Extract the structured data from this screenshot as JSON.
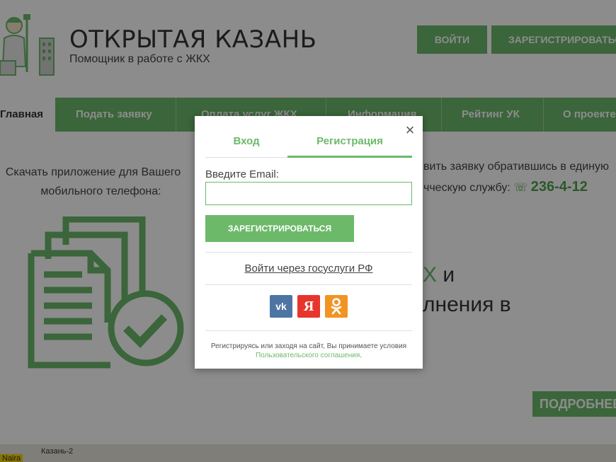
{
  "site": {
    "title": "ОТКРЫТАЯ КАЗАНЬ",
    "subtitle": "Помощник в работе с ЖКХ"
  },
  "header_buttons": {
    "login": "ВОЙТИ",
    "register": "ЗАРЕГИСТРИРОВАТЬСЯ"
  },
  "nav": {
    "items": [
      {
        "label": "Главная",
        "active": true
      },
      {
        "label": "Подать заявку"
      },
      {
        "label": "Оплата услуг ЖКХ"
      },
      {
        "label": "Информация"
      },
      {
        "label": "Рейтинг УК"
      },
      {
        "label": "О проекте"
      }
    ]
  },
  "app_promo": {
    "line1": "Скачать приложение для Вашего",
    "line2": "мобильного телефона:"
  },
  "contact": {
    "line1": "вить заявку обратившись в единую",
    "line2": "чческую службу:",
    "phone": "236-4-12"
  },
  "hero": {
    "line1_accent": "Х",
    "line1_rest": " и",
    "line2": "лнения в"
  },
  "more_button": "ПОДРОБНЕЕ",
  "map": {
    "label1": "Naira",
    "label2": "Казань-2"
  },
  "modal": {
    "close_symbol": "×",
    "tabs": {
      "login": "Вход",
      "register": "Регистрация"
    },
    "email_label": "Введите Email:",
    "email_value": "",
    "email_placeholder": "",
    "submit": "ЗАРЕГИСТРИРОВАТЬСЯ",
    "gosuslugi": "Войти через госуслуги РФ",
    "social": {
      "vk": "vk",
      "yandex": "Я",
      "ok": "ok"
    },
    "terms_text": "Регистрируясь или заходя на сайт, Вы принимаете условия ",
    "terms_link": "Пользовательского соглашения",
    "terms_end": "."
  },
  "colors": {
    "brand_green": "#6cb96a",
    "vk_blue": "#4c75a3",
    "yandex_red": "#e8352b",
    "ok_orange": "#f29424"
  }
}
